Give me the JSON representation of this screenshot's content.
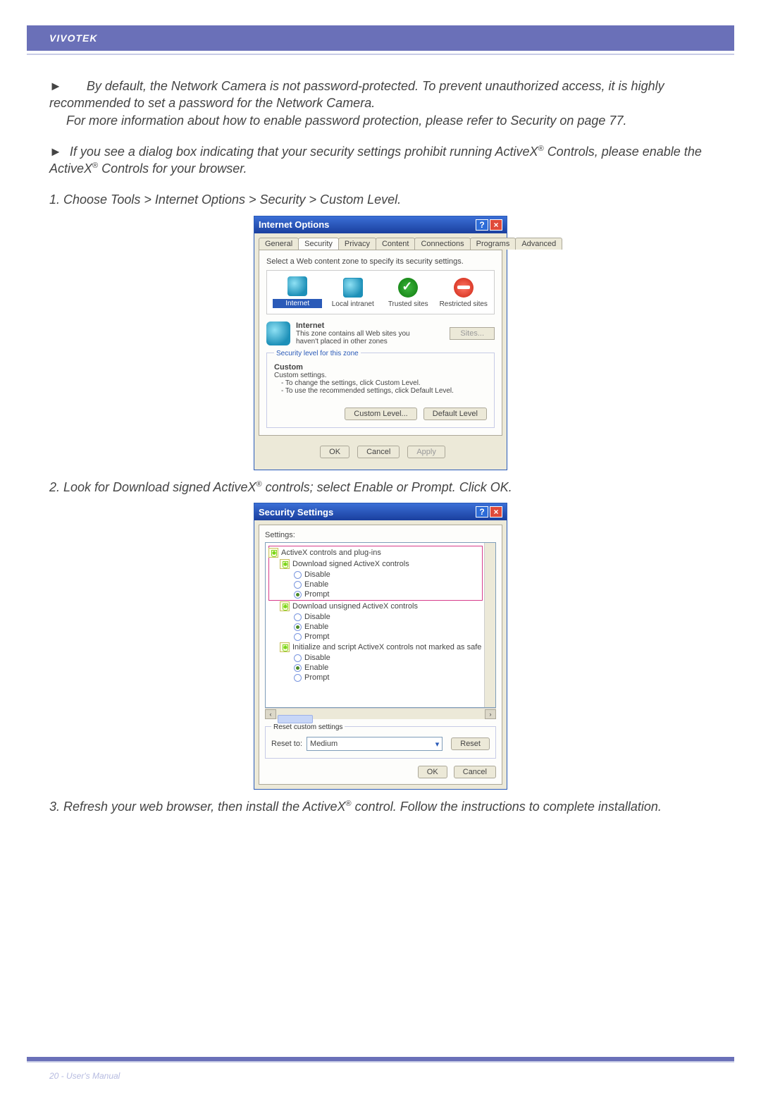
{
  "header": {
    "brand": "VIVOTEK"
  },
  "para1": {
    "arrow": "►",
    "line1": "By default, the Network Camera is not password-protected. To prevent unauthorized access, it is highly recommended to set a password for the Network Camera.",
    "line2": "For more information about how to enable password protection, please refer to Security on page 77."
  },
  "para2": {
    "arrow": "►",
    "text_a": "If you see a dialog box indicating that your security settings prohibit running ActiveX",
    "text_b": " Controls, please enable the ActiveX",
    "text_c": " Controls for your browser.",
    "reg": "®"
  },
  "step1": {
    "text": "1. Choose Tools > Internet Options > Security > Custom Level."
  },
  "step2": {
    "text_a": "2. Look for Download signed ActiveX",
    "text_b": " controls; select Enable or Prompt. Click ",
    "ok": "OK",
    "period": ".",
    "reg": "®"
  },
  "step3": {
    "text_a": "3. Refresh your web browser, then install the ActiveX",
    "text_b": " control. Follow the instructions to complete installation.",
    "reg": "®"
  },
  "dlg1": {
    "title": "Internet Options",
    "help": "?",
    "close": "×",
    "tabs": [
      "General",
      "Security",
      "Privacy",
      "Content",
      "Connections",
      "Programs",
      "Advanced"
    ],
    "active_tab": 1,
    "zone_prompt": "Select a Web content zone to specify its security settings.",
    "zones": [
      {
        "label": "Internet"
      },
      {
        "label": "Local intranet"
      },
      {
        "label": "Trusted sites"
      },
      {
        "label": "Restricted sites"
      }
    ],
    "zone_name": "Internet",
    "zone_desc": "This zone contains all Web sites you haven't placed in other zones",
    "sites_btn": "Sites...",
    "fieldset_legend": "Security level for this zone",
    "custom_label": "Custom",
    "custom_sub": "Custom settings.",
    "custom_li1": "- To change the settings, click Custom Level.",
    "custom_li2": "- To use the recommended settings, click Default Level.",
    "custom_level_btn": "Custom Level...",
    "default_level_btn": "Default Level",
    "ok_btn": "OK",
    "cancel_btn": "Cancel",
    "apply_btn": "Apply"
  },
  "dlg2": {
    "title": "Security Settings",
    "help": "?",
    "close": "×",
    "settings_label": "Settings:",
    "groupA": {
      "header": "ActiveX controls and plug-ins",
      "item": "Download signed ActiveX controls",
      "opt_disable": "Disable",
      "opt_enable": "Enable",
      "opt_prompt": "Prompt",
      "selected": "Prompt"
    },
    "groupB": {
      "item": "Download unsigned ActiveX controls",
      "opt_disable": "Disable",
      "opt_enable": "Enable",
      "opt_prompt": "Prompt",
      "selected": "Enable"
    },
    "groupC": {
      "item": "Initialize and script ActiveX controls not marked as safe",
      "opt_disable": "Disable",
      "opt_enable": "Enable",
      "opt_prompt": "Prompt",
      "selected": "Enable"
    },
    "reset_legend": "Reset custom settings",
    "reset_to_label": "Reset to:",
    "reset_value": "Medium",
    "reset_btn": "Reset",
    "ok_btn": "OK",
    "cancel_btn": "Cancel"
  },
  "footer": {
    "page": "20 - User's Manual"
  }
}
